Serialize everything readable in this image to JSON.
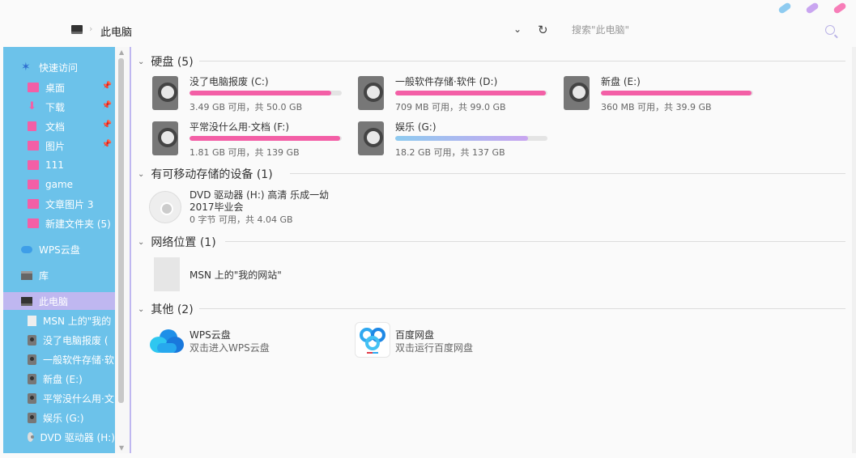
{
  "toolbar": {
    "breadcrumb": "此电脑",
    "search_placeholder": "搜索\"此电脑\"",
    "accent_dots": [
      "#8ecbf0",
      "#c9a5f0",
      "#f77db8"
    ]
  },
  "sidebar": {
    "items": [
      {
        "label": "快速访问",
        "icon": "star-icon"
      },
      {
        "label": "桌面",
        "icon": "folder-icon",
        "pinned": true
      },
      {
        "label": "下载",
        "icon": "download-icon",
        "pinned": true
      },
      {
        "label": "文档",
        "icon": "document-icon",
        "pinned": true
      },
      {
        "label": "图片",
        "icon": "picture-icon",
        "pinned": true
      },
      {
        "label": "111",
        "icon": "folder-icon"
      },
      {
        "label": "game",
        "icon": "folder-icon"
      },
      {
        "label": "文章图片 3",
        "icon": "folder-icon"
      },
      {
        "label": "新建文件夹 (5)",
        "icon": "folder-icon"
      },
      {
        "label": "WPS云盘",
        "icon": "cloud-icon"
      },
      {
        "label": "库",
        "icon": "library-icon"
      },
      {
        "label": "此电脑",
        "icon": "computer-icon",
        "selected": true
      },
      {
        "label": "MSN 上的\"我的",
        "icon": "document-icon"
      },
      {
        "label": "没了电脑报废 (",
        "icon": "drive-icon"
      },
      {
        "label": "一般软件存储·软",
        "icon": "drive-icon"
      },
      {
        "label": "新盘 (E:)",
        "icon": "drive-icon"
      },
      {
        "label": "平常没什么用·文",
        "icon": "drive-icon"
      },
      {
        "label": "娱乐 (G:)",
        "icon": "drive-icon"
      },
      {
        "label": "DVD 驱动器 (H:)",
        "icon": "dvd-icon"
      }
    ]
  },
  "groups": {
    "hard_disks": "硬盘 (5)",
    "removable": "有可移动存储的设备 (1)",
    "network": "网络位置 (1)",
    "other": "其他 (2)"
  },
  "drives": [
    {
      "name": "没了电脑报废 (C:)",
      "space": "3.49 GB 可用，共 50.0 GB",
      "used": 0.93,
      "color": "#f35fa6"
    },
    {
      "name": "一般软件存储·软件 (D:)",
      "space": "709 MB 可用，共 99.0 GB",
      "used": 0.99,
      "color": "#f35fa6"
    },
    {
      "name": "新盘 (E:)",
      "space": "360 MB 可用，共 39.9 GB",
      "used": 0.99,
      "color": "#f35fa6"
    },
    {
      "name": "平常没什么用·文档 (F:)",
      "space": "1.81 GB 可用，共 139 GB",
      "used": 0.99,
      "color": "#f35fa6"
    },
    {
      "name": "娱乐 (G:)",
      "space": "18.2 GB 可用，共 137 GB",
      "used": 0.87,
      "color": "linear-gradient(90deg,#8ecbf0,#c9a5f0)"
    }
  ],
  "dvd": {
    "line1": "DVD 驱动器 (H:) 高清  乐成一幼",
    "line2": "2017毕业会",
    "space": "0 字节 可用，共 4.04 GB"
  },
  "network_item": "MSN 上的\"我的网站\"",
  "others": [
    {
      "name": "WPS云盘",
      "desc": "双击进入WPS云盘"
    },
    {
      "name": "百度网盘",
      "desc": "双击运行百度网盘"
    }
  ]
}
